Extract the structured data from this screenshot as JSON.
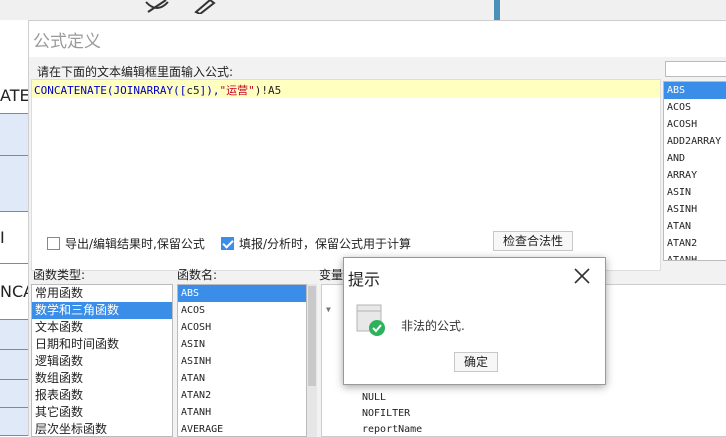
{
  "background": {
    "cells": [
      "ATE",
      "",
      "",
      "I",
      "NCA",
      "",
      "",
      "",
      ""
    ]
  },
  "dialog": {
    "title": "公式定义",
    "instruction": "请在下面的文本编辑框里面输入公式:",
    "formula_parts": {
      "fn1": "CONCATENATE(JOINARRAY([",
      "ref": "c5",
      "mid": "]),",
      "str": "\"运营\"",
      "tail": ")!A5"
    },
    "right_functions": [
      "ABS",
      "ACOS",
      "ACOSH",
      "ADD2ARRAY",
      "AND",
      "ARRAY",
      "ASIN",
      "ASINH",
      "ATAN",
      "ATAN2",
      "ATANH"
    ],
    "checkbox_export": {
      "label": "导出/编辑结果时,保留公式",
      "checked": false
    },
    "checkbox_fill": {
      "label": "填报/分析时，保留公式用于计算",
      "checked": true
    },
    "check_button": "检查合法性",
    "label_type": "函数类型:",
    "label_name": "函数名:",
    "label_var": "变量",
    "function_types": [
      "常用函数",
      "数学和三角函数",
      "文本函数",
      "日期和时间函数",
      "逻辑函数",
      "数组函数",
      "报表函数",
      "其它函数",
      "层次坐标函数"
    ],
    "function_names": [
      "ABS",
      "ACOS",
      "ACOSH",
      "ASIN",
      "ASINH",
      "ATAN",
      "ATAN2",
      "ATANH",
      "AVERAGE"
    ],
    "variables": [
      "NULL",
      "NOFILTER",
      "reportName"
    ]
  },
  "tip": {
    "title": "提示",
    "message": "非法的公式.",
    "ok": "确定"
  },
  "colors": {
    "accent": "#3b8ee8",
    "highlight": "#ffffc0",
    "function": "#0000c8",
    "string": "#c8002a"
  }
}
